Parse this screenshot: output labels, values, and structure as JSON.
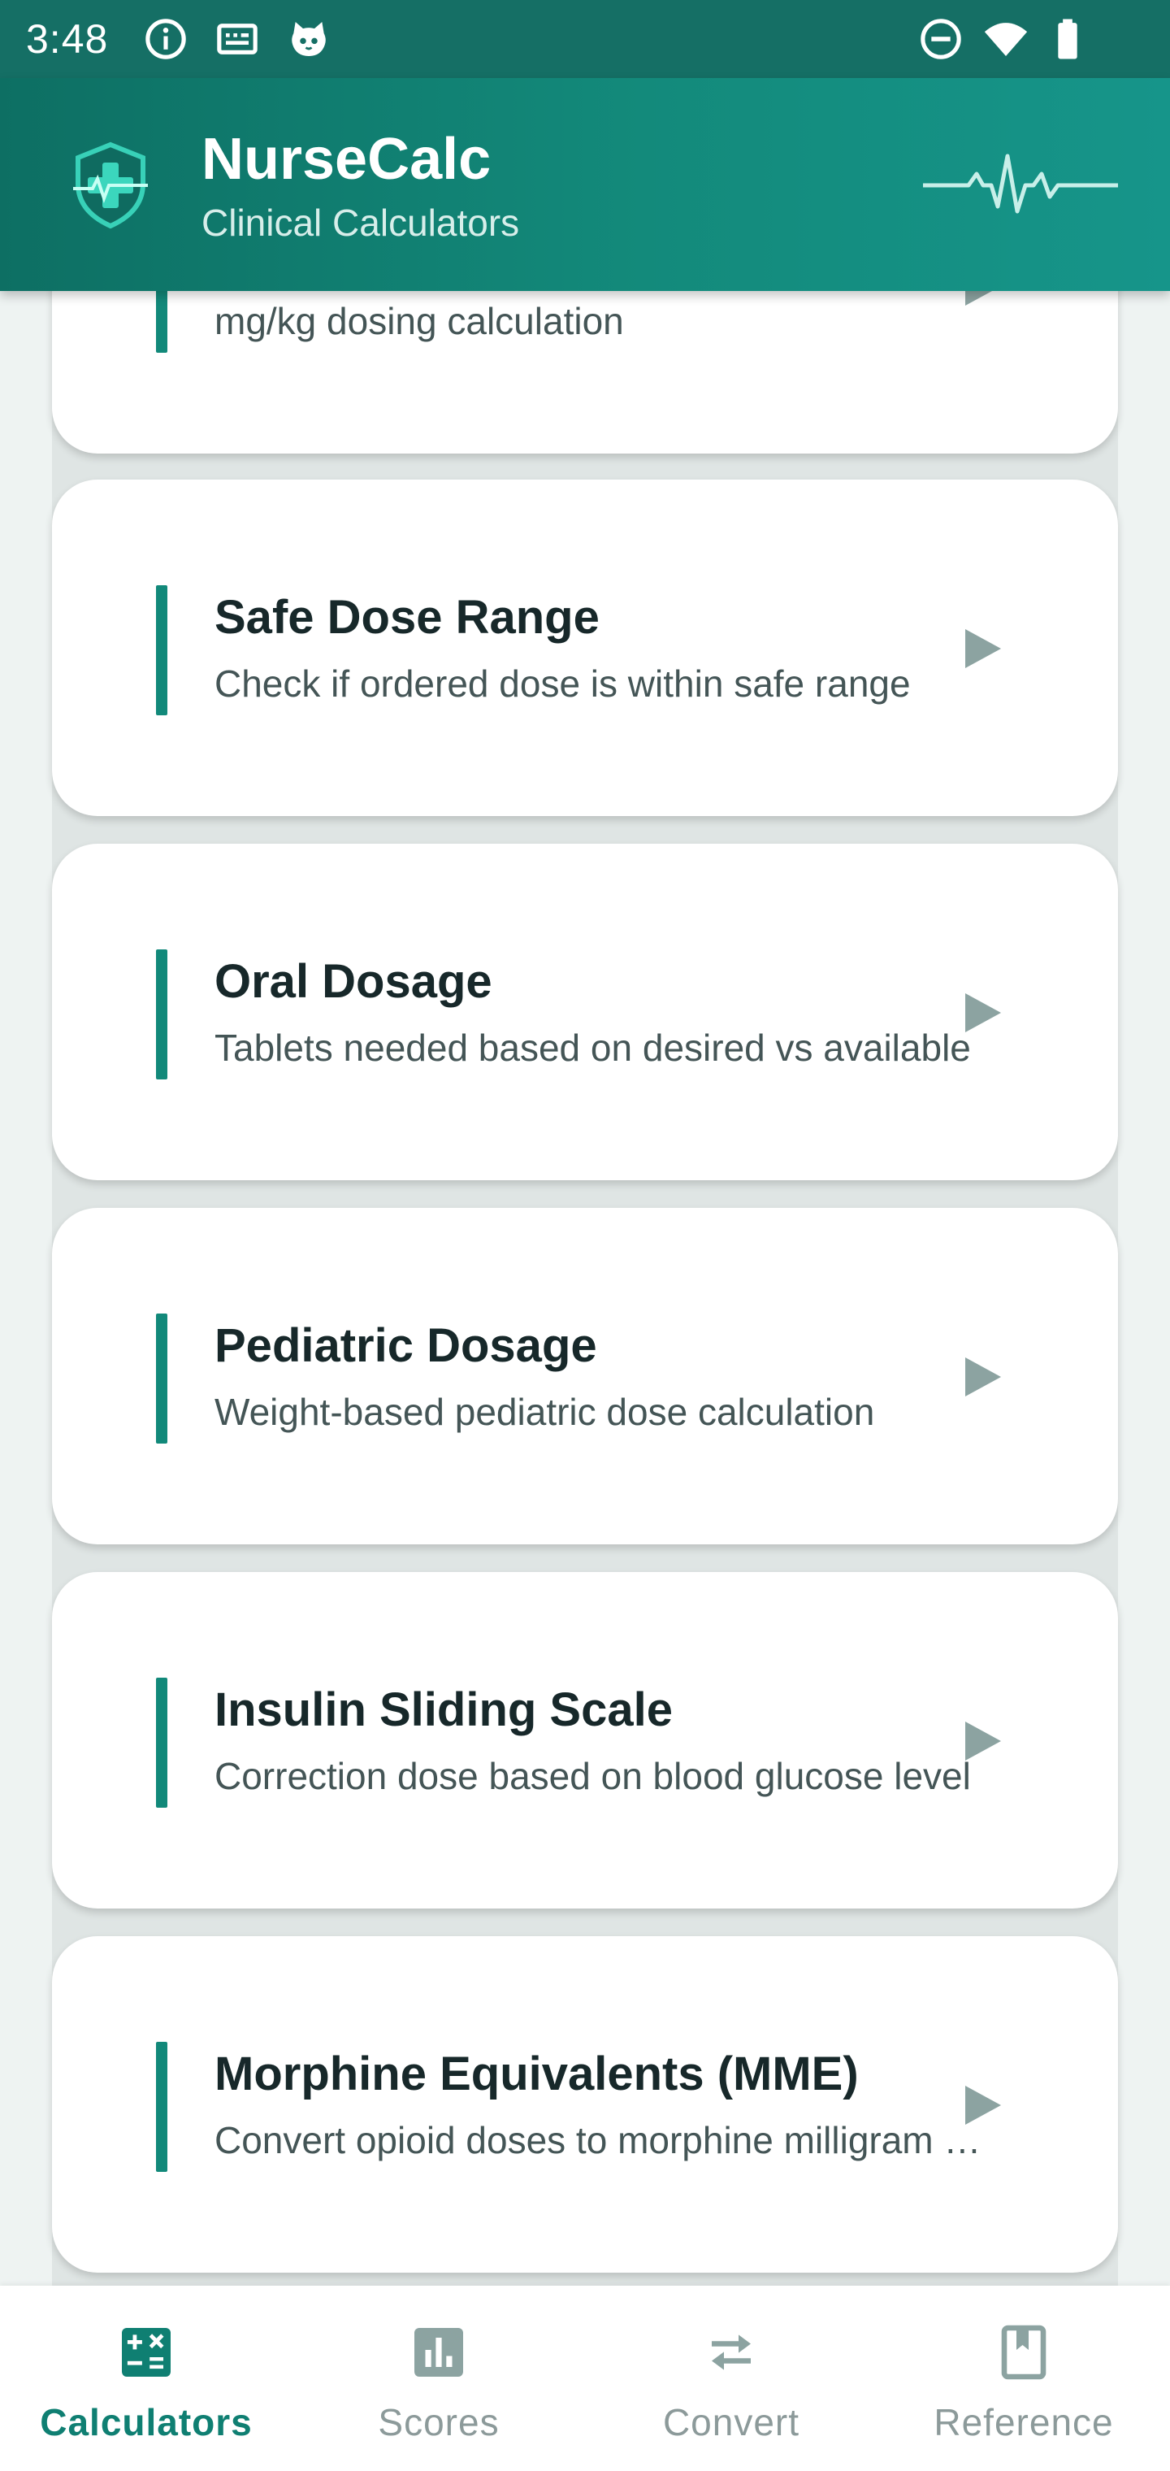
{
  "status_bar": {
    "time": "3:48",
    "icons": [
      "info-icon",
      "keyboard-icon",
      "cat-face-icon",
      "do-not-disturb-icon",
      "wifi-icon",
      "battery-icon"
    ]
  },
  "app_bar": {
    "title": "NurseCalc",
    "subtitle": "Clinical Calculators",
    "logo_icon": "shield-medical-icon",
    "decoration_icon": "heartbeat-icon"
  },
  "calculators": [
    {
      "title": "",
      "description": "mg/kg dosing calculation"
    },
    {
      "title": "Safe Dose Range",
      "description": "Check if ordered dose is within safe range"
    },
    {
      "title": "Oral Dosage",
      "description": "Tablets needed based on desired vs available"
    },
    {
      "title": "Pediatric Dosage",
      "description": "Weight-based pediatric dose calculation"
    },
    {
      "title": "Insulin Sliding Scale",
      "description": "Correction dose based on blood glucose level"
    },
    {
      "title": "Morphine Equivalents (MME)",
      "description": "Convert opioid doses to morphine milligram equivalents"
    }
  ],
  "bottom_nav": {
    "active": "Calculators",
    "items": [
      {
        "label": "Calculators",
        "icon": "calculator-icon"
      },
      {
        "label": "Scores",
        "icon": "bar-chart-icon"
      },
      {
        "label": "Convert",
        "icon": "swap-arrows-icon"
      },
      {
        "label": "Reference",
        "icon": "bookmark-book-icon"
      }
    ]
  },
  "colors": {
    "primary": "#12897a",
    "primary_dark": "#156f65",
    "nav_inactive": "#8c9a9a",
    "card_background": "#ffffff",
    "title_text": "#17282a"
  }
}
